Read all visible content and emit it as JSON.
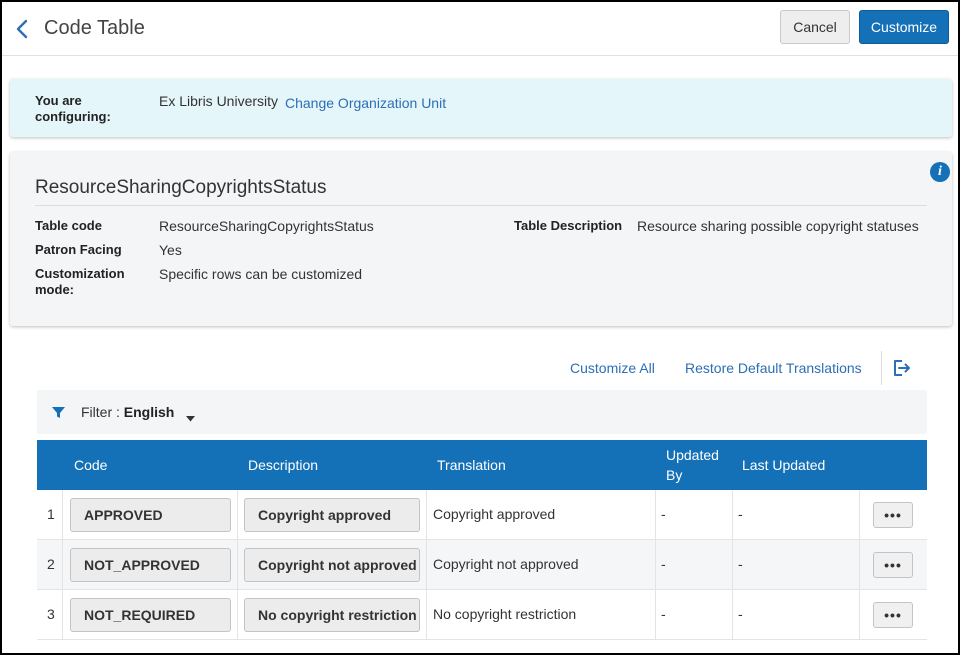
{
  "header": {
    "title": "Code Table",
    "cancel_label": "Cancel",
    "customize_label": "Customize"
  },
  "config": {
    "label": "You are configuring:",
    "value": "Ex Libris University",
    "change_link": "Change Organization Unit"
  },
  "info": {
    "title": "ResourceSharingCopyrightsStatus",
    "table_code_label": "Table code",
    "table_code_value": "ResourceSharingCopyrightsStatus",
    "patron_facing_label": "Patron Facing",
    "patron_facing_value": "Yes",
    "customization_mode_label": "Customization mode:",
    "customization_mode_value": "Specific rows can be customized",
    "table_description_label": "Table Description",
    "table_description_value": "Resource sharing possible copyright statuses"
  },
  "actions": {
    "customize_all": "Customize All",
    "restore_default": "Restore Default Translations"
  },
  "filter": {
    "label": "Filter :",
    "value": "English"
  },
  "table": {
    "columns": {
      "code": "Code",
      "description": "Description",
      "translation": "Translation",
      "updated_by": "Updated By",
      "last_updated": "Last Updated"
    },
    "rows": [
      {
        "num": "1",
        "code": "APPROVED",
        "description": "Copyright approved",
        "translation": "Copyright approved",
        "updated_by": "-",
        "last_updated": "-",
        "more": "•••"
      },
      {
        "num": "2",
        "code": "NOT_APPROVED",
        "description": "Copyright not approved",
        "translation": "Copyright not approved",
        "updated_by": "-",
        "last_updated": "-",
        "more": "•••"
      },
      {
        "num": "3",
        "code": "NOT_REQUIRED",
        "description": "No copyright restriction",
        "translation": "No copyright restriction",
        "updated_by": "-",
        "last_updated": "-",
        "more": "•••"
      }
    ]
  },
  "colors": {
    "primary": "#1571b7",
    "link": "#2d6fb4",
    "banner_bg": "#e5f6fb",
    "panel_bg": "#f3f5f6"
  },
  "icons": {
    "back": "chevron-left-icon",
    "info": "info-icon",
    "export": "export-icon",
    "filter": "filter-icon",
    "caret": "caret-down-icon"
  }
}
